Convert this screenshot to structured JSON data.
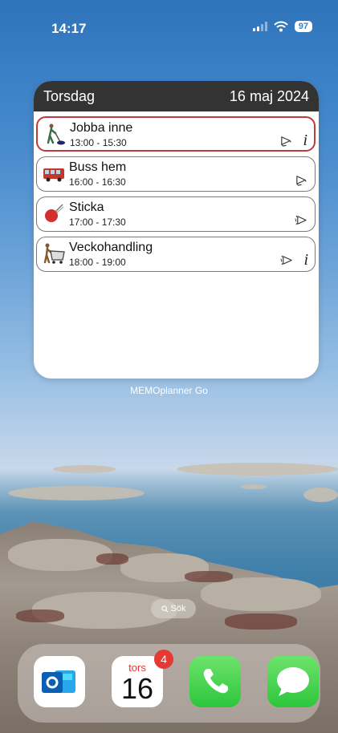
{
  "status_bar": {
    "time": "14:17",
    "battery": "97"
  },
  "widget": {
    "day": "Torsdag",
    "date": "16 maj 2024",
    "app_name": "MEMOplanner Go",
    "activities": [
      {
        "title": "Jobba inne",
        "time": "13:00 - 15:30",
        "active": true
      },
      {
        "title": "Buss hem",
        "time": "16:00 - 16:30",
        "active": false
      },
      {
        "title": "Sticka",
        "time": "17:00 - 17:30",
        "active": false
      },
      {
        "title": "Veckohandling",
        "time": "18:00 - 19:00",
        "active": false
      }
    ]
  },
  "search": {
    "label": "Sök"
  },
  "dock": {
    "apps": [
      "outlook",
      "calendar",
      "phone",
      "messages"
    ],
    "calendar_day": "tors",
    "calendar_date": "16",
    "calendar_badge": "4"
  }
}
